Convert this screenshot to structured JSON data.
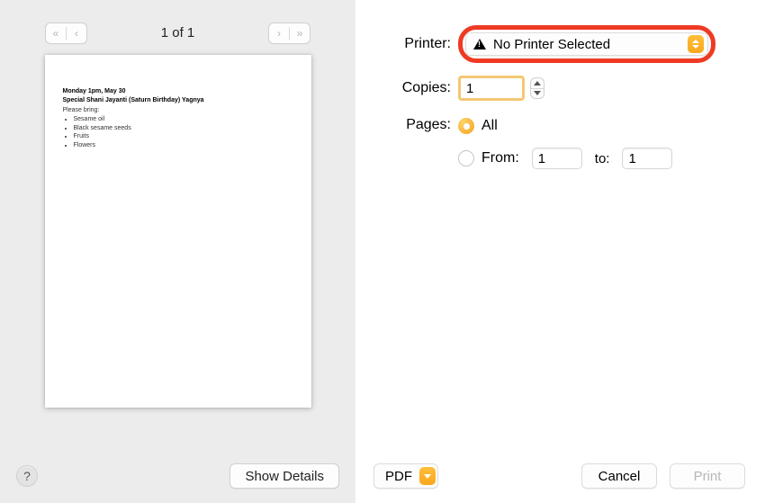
{
  "preview": {
    "page_indicator": "1 of 1",
    "document": {
      "line1": "Monday 1pm, May 30",
      "line2": "Special Shani Jayanti (Saturn Birthday) Yagnya",
      "line3": "Please bring:",
      "items": [
        "Sesame oil",
        "Black sesame seeds",
        "Fruits",
        "Flowers"
      ]
    },
    "help_label": "?",
    "show_details_label": "Show Details"
  },
  "fields": {
    "printer": {
      "label": "Printer:",
      "value": "No Printer Selected"
    },
    "copies": {
      "label": "Copies:",
      "value": "1"
    },
    "pages": {
      "label": "Pages:",
      "option_all": "All",
      "option_from": "From:",
      "from_value": "1",
      "to_label": "to:",
      "to_value": "1"
    }
  },
  "footer": {
    "pdf_label": "PDF",
    "cancel_label": "Cancel",
    "print_label": "Print"
  }
}
